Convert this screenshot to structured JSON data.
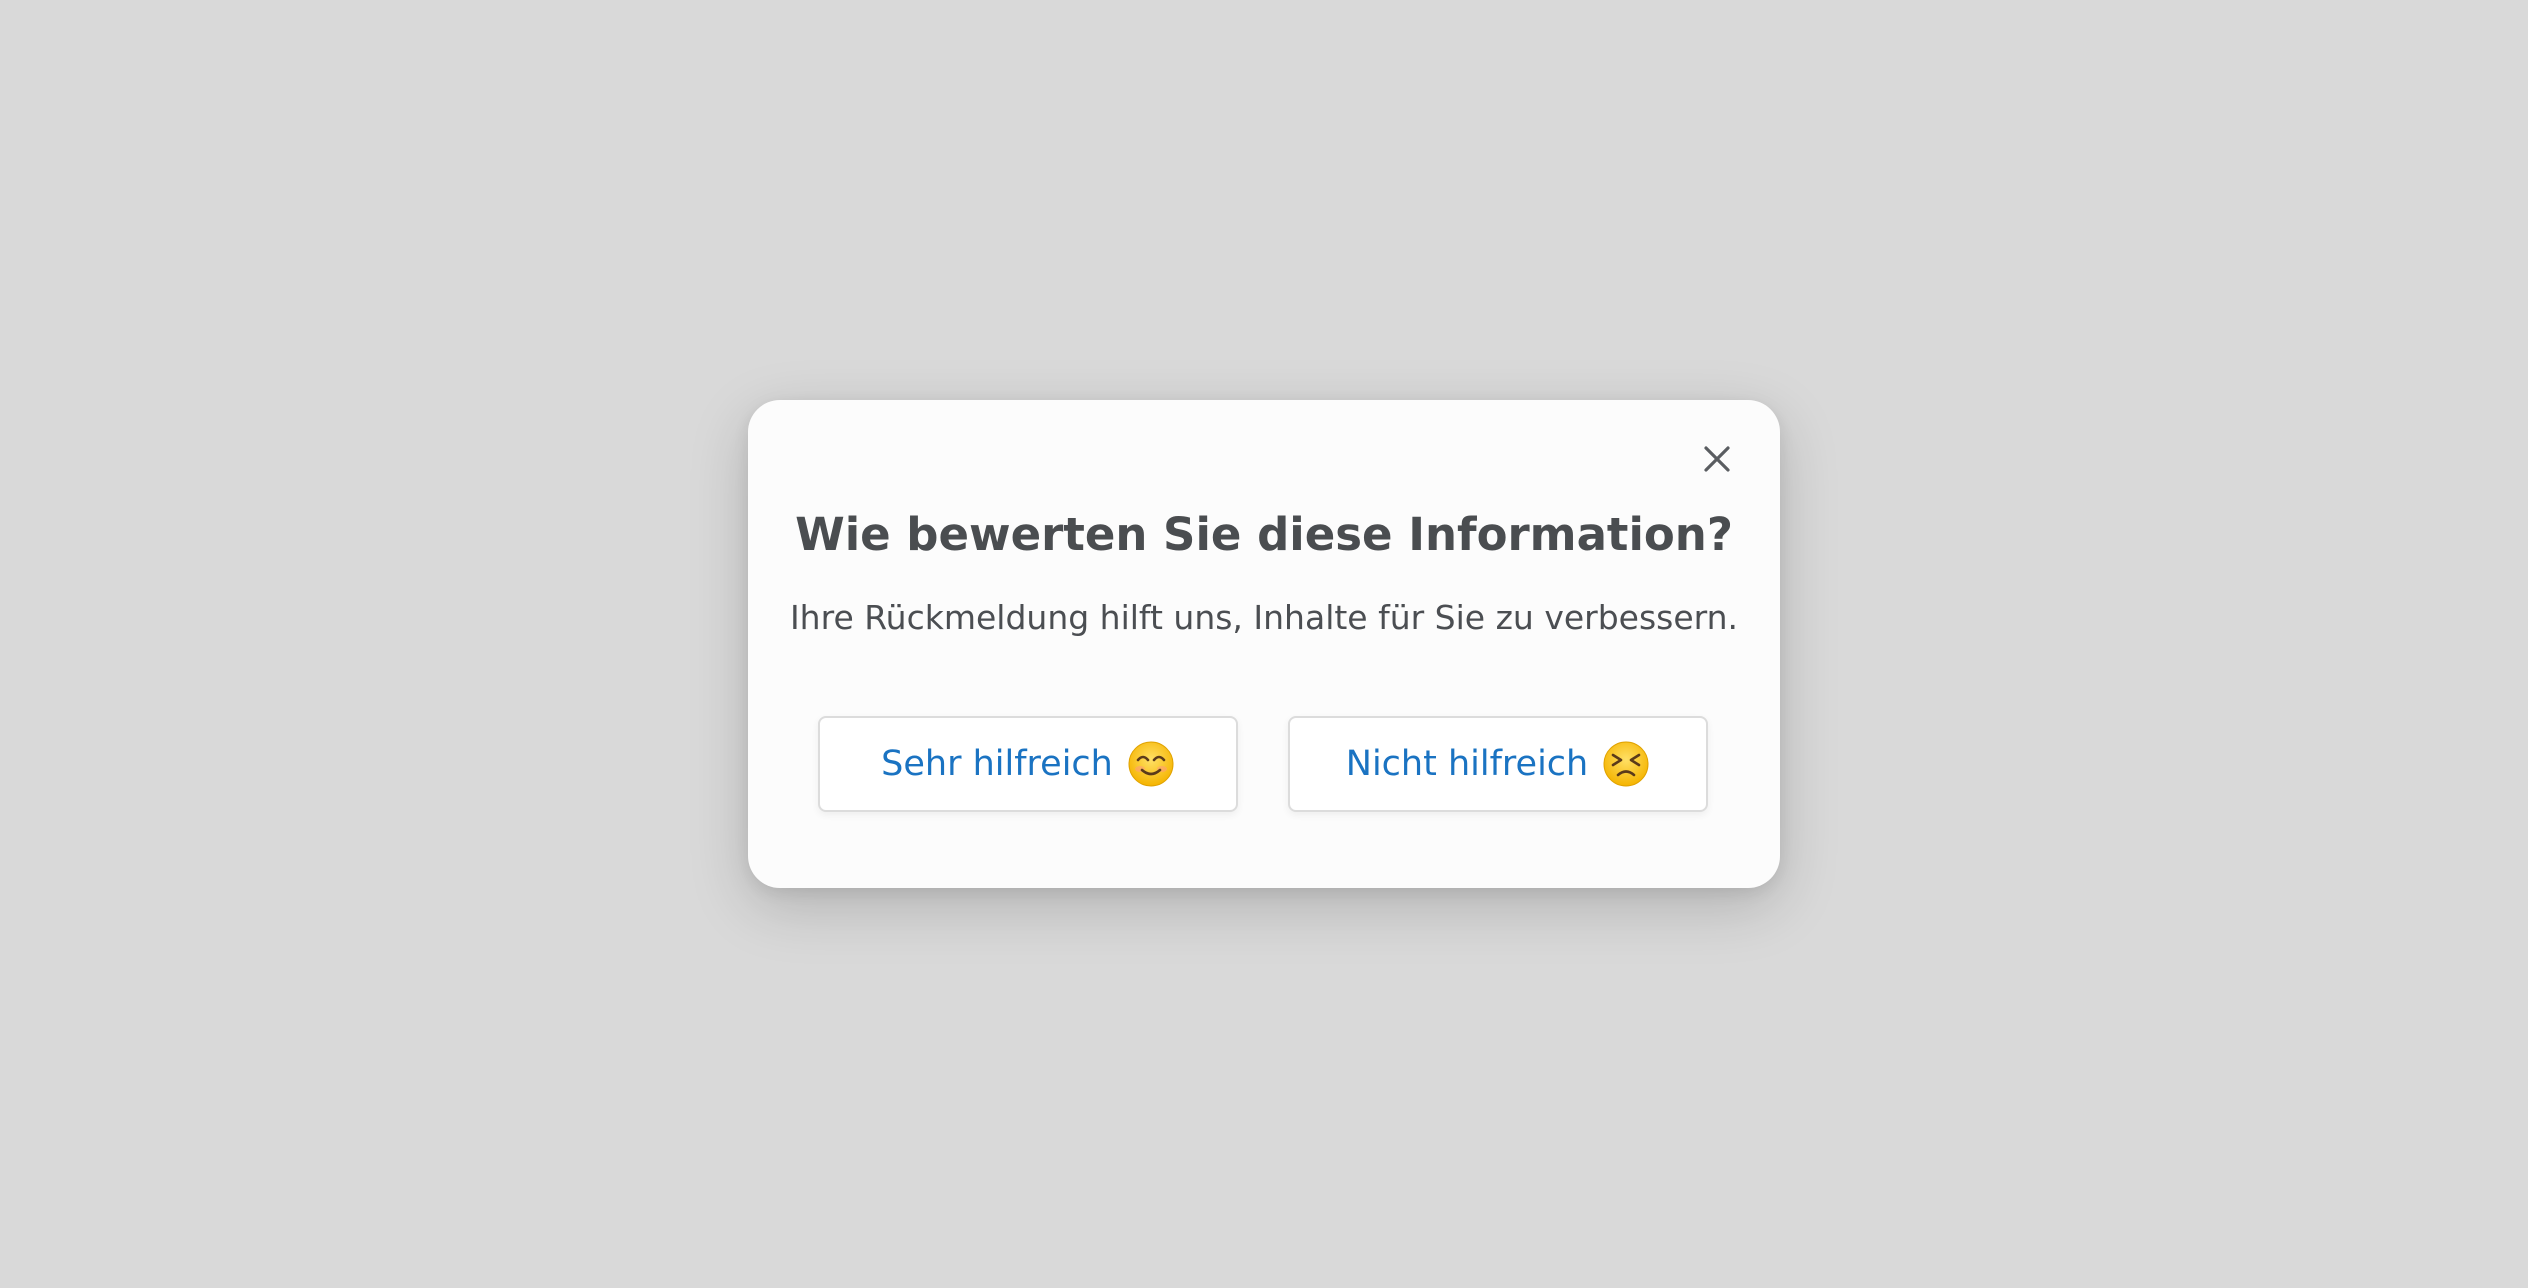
{
  "dialog": {
    "title": "Wie bewerten Sie diese Information?",
    "subtitle": "Ihre Rückmeldung hilft uns, Inhalte für Sie zu verbessern.",
    "close_icon": "close-icon",
    "buttons": [
      {
        "label": "Sehr hilfreich",
        "icon": "smiling-face-emoji"
      },
      {
        "label": "Nicht hilfreich",
        "icon": "persevering-face-emoji"
      }
    ]
  },
  "colors": {
    "backdrop": "#d9d9d9",
    "dialog_bg": "#fcfcfc",
    "title": "#4a4d50",
    "link_blue": "#1a73c2"
  }
}
